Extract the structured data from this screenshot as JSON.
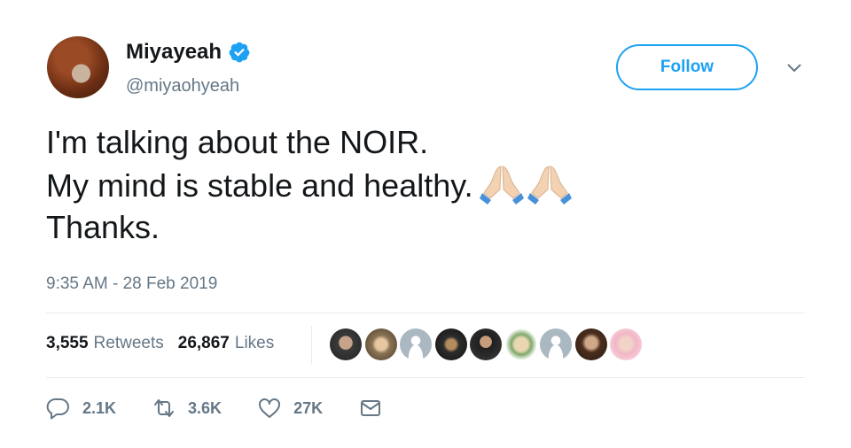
{
  "user": {
    "display_name": "Miyayeah",
    "handle": "@miyaohyeah",
    "verified": true
  },
  "follow_button": {
    "label": "Follow"
  },
  "tweet": {
    "lines": [
      "I'm talking about the NOIR.",
      "My mind is stable and healthy.",
      "Thanks."
    ],
    "emojis": [
      "folded-hands",
      "folded-hands"
    ],
    "timestamp": "9:35 AM - 28 Feb 2019"
  },
  "stats": {
    "retweets": {
      "count": "3,555",
      "label": "Retweets"
    },
    "likes": {
      "count": "26,867",
      "label": "Likes"
    }
  },
  "liker_avatars": [
    "avatar-1",
    "avatar-2",
    "default-avatar",
    "avatar-4",
    "avatar-5",
    "avatar-6",
    "default-avatar",
    "avatar-8",
    "avatar-9"
  ],
  "actions": {
    "replies": "2.1K",
    "retweets": "3.6K",
    "likes": "27K"
  },
  "colors": {
    "accent": "#1da1f2",
    "text_primary": "#14171a",
    "text_secondary": "#657786",
    "divider": "#e6ecf0"
  }
}
